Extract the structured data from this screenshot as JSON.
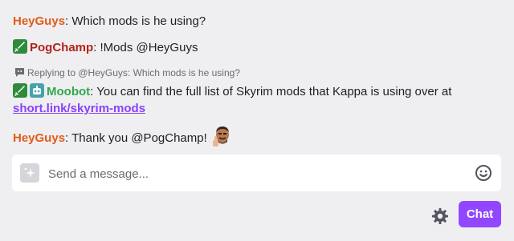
{
  "colors": {
    "heyguys": "#e35b17",
    "pogchamp": "#b3221a",
    "moobot": "#2fa84f",
    "link": "#8a3ffc",
    "chat_button": "#9147ff"
  },
  "messages": [
    {
      "user": "HeyGuys",
      "separator": ": ",
      "text": "Which mods is he using?"
    },
    {
      "user": "PogChamp",
      "separator": ": ",
      "text": "!Mods @HeyGuys",
      "badges": [
        "sword-icon"
      ]
    },
    {
      "reply_to": "Replying to @HeyGuys: Which mods is he using?",
      "user": "Moobot",
      "separator": ": ",
      "text": "You can find the full list of Skyrim mods that Kappa is using over at",
      "link": "short.link/skyrim-mods",
      "badges": [
        "sword-icon",
        "robot-icon"
      ]
    },
    {
      "user": "HeyGuys",
      "separator": ": ",
      "text": "Thank you @PogChamp!",
      "emote": "thumbs-up-face-emote"
    }
  ],
  "input": {
    "placeholder": "Send a message..."
  },
  "chat_button": {
    "label": "Chat"
  }
}
